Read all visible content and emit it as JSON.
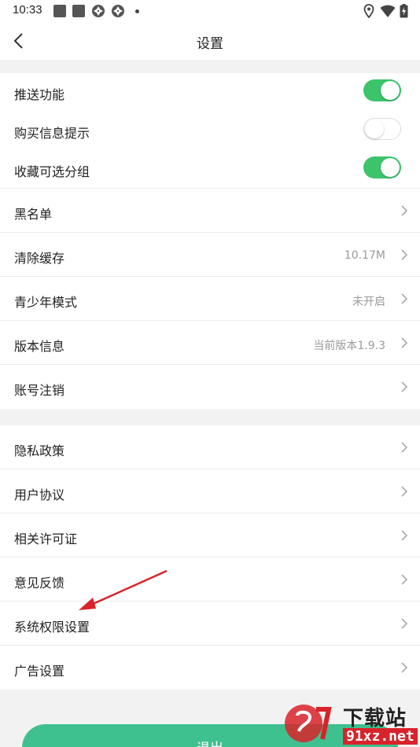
{
  "status_bar": {
    "time": "10:33"
  },
  "header": {
    "title": "设置"
  },
  "group1": {
    "toggles": [
      {
        "label": "推送功能",
        "on": true
      },
      {
        "label": "购买信息提示",
        "on": false
      },
      {
        "label": "收藏可选分组",
        "on": true
      }
    ],
    "items": [
      {
        "label": "黑名单",
        "value": ""
      },
      {
        "label": "清除缓存",
        "value": "10.17M"
      },
      {
        "label": "青少年模式",
        "value": "未开启"
      },
      {
        "label": "版本信息",
        "value": "当前版本1.9.3"
      },
      {
        "label": "账号注销",
        "value": ""
      }
    ]
  },
  "group2": {
    "items": [
      {
        "label": "隐私政策"
      },
      {
        "label": "用户协议"
      },
      {
        "label": "相关许可证"
      },
      {
        "label": "意见反馈"
      },
      {
        "label": "系统权限设置"
      },
      {
        "label": "广告设置"
      }
    ]
  },
  "logout": {
    "label": "退出"
  },
  "watermark": {
    "text": "下载站",
    "domain": "91xz.net"
  },
  "colors": {
    "accent_green": "#3cc46b",
    "logout_green": "#3fc08f",
    "annotation_red": "#d8232a"
  }
}
